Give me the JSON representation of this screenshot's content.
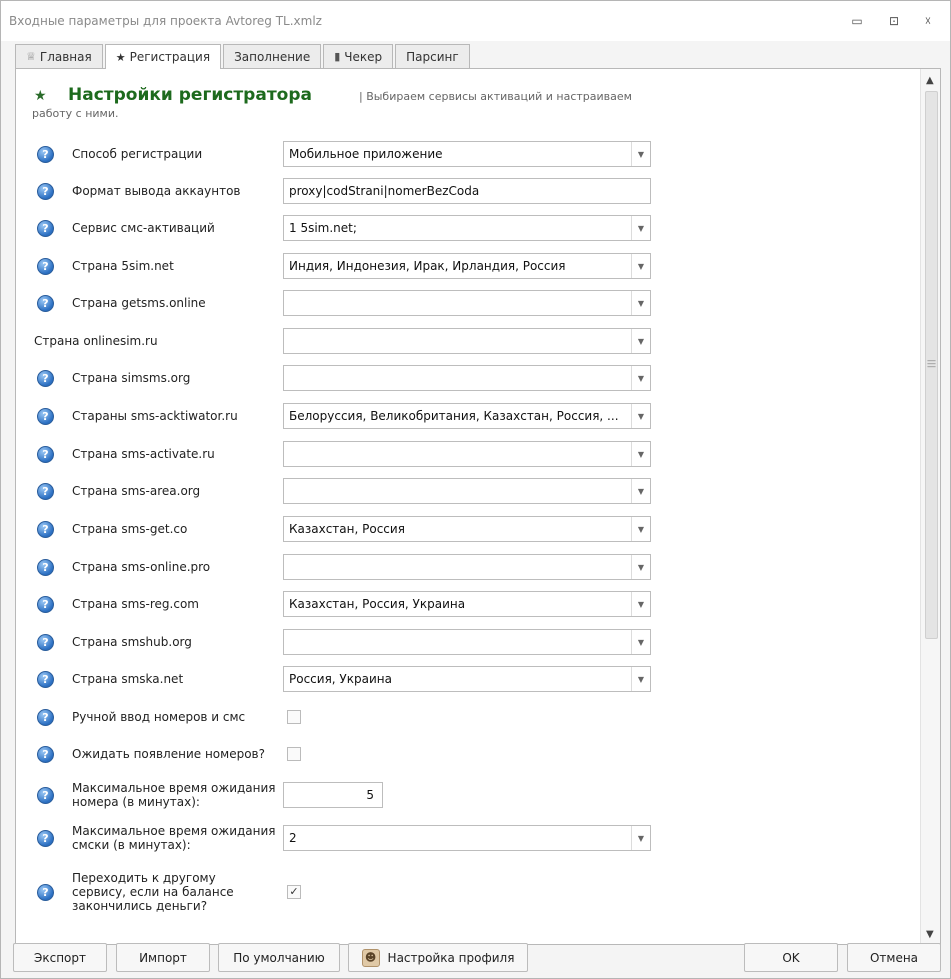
{
  "window": {
    "title": "Входные параметры для проекта Avtoreg TL.xmlz",
    "controls": {
      "minimize": "▭",
      "maximize": "⊡",
      "close": "☓"
    }
  },
  "tabs": [
    {
      "label": "Главная",
      "icon": "home-icon"
    },
    {
      "label": "Регистрация",
      "icon": "star-icon",
      "active": true
    },
    {
      "label": "Заполнение",
      "icon": ""
    },
    {
      "label": "Чекер",
      "icon": "checker-icon"
    },
    {
      "label": "Парсинг",
      "icon": ""
    }
  ],
  "header": {
    "title": "Настройки регистратора",
    "desc_line1": "| Выбираем сервисы активаций и настраиваем",
    "desc_line2": "работу с ними."
  },
  "rows": [
    {
      "label": "Способ регистрации",
      "type": "combo",
      "value": "Мобильное приложение",
      "icon": true
    },
    {
      "label": "Формат вывода аккаунтов",
      "type": "text",
      "value": "proxy|codStrani|nomerBezCoda",
      "icon": true
    },
    {
      "label": "Сервис смс-активаций",
      "type": "combo",
      "value": "1 5sim.net;",
      "icon": true
    },
    {
      "label": "Страна 5sim.net",
      "type": "combo",
      "value": "Индия, Индонезия, Ирак, Ирландия, Россия",
      "icon": true
    },
    {
      "label": "Страна getsms.online",
      "type": "combo",
      "value": "",
      "icon": true
    },
    {
      "label": "Страна onlinesim.ru",
      "type": "combo",
      "value": "",
      "icon": false
    },
    {
      "label": "Страна simsms.org",
      "type": "combo",
      "value": "",
      "icon": true
    },
    {
      "label": "Стараны sms-acktiwator.ru",
      "type": "combo",
      "value": "Белоруссия, Великобритания, Казахстан, Россия, ...",
      "icon": true
    },
    {
      "label": "Страна sms-activate.ru",
      "type": "combo",
      "value": "",
      "icon": true
    },
    {
      "label": "Страна sms-area.org",
      "type": "combo",
      "value": "",
      "icon": true
    },
    {
      "label": "Страна sms-get.co",
      "type": "combo",
      "value": "Казахстан, Россия",
      "icon": true
    },
    {
      "label": "Страна sms-online.pro",
      "type": "combo",
      "value": "",
      "icon": true
    },
    {
      "label": "Страна sms-reg.com",
      "type": "combo",
      "value": "Казахстан, Россия, Украина",
      "icon": true
    },
    {
      "label": "Страна smshub.org",
      "type": "combo",
      "value": "",
      "icon": true
    },
    {
      "label": "Страна smska.net",
      "type": "combo",
      "value": "Россия, Украина",
      "icon": true
    },
    {
      "label": "Ручной ввод номеров и смс",
      "type": "checkbox",
      "checked": false,
      "icon": true
    },
    {
      "label": "Ожидать появление номеров?",
      "type": "checkbox",
      "checked": false,
      "icon": true
    },
    {
      "label": "Максимальное время ожидания\nномера (в минутах):",
      "type": "number",
      "value": "5",
      "icon": true
    },
    {
      "label": "Максимальное время ожидания\nсмски (в минутах):",
      "type": "combo",
      "value": "2",
      "icon": true
    },
    {
      "label": "Переходить к другому\nсервису, если на балансе\nзакончились деньги?",
      "type": "checkbox",
      "checked": true,
      "icon": true
    }
  ],
  "footer": {
    "export": "Экспорт",
    "import": "Импорт",
    "defaults": "По умолчанию",
    "profile": "Настройка профиля",
    "ok": "OK",
    "cancel": "Отмена"
  }
}
